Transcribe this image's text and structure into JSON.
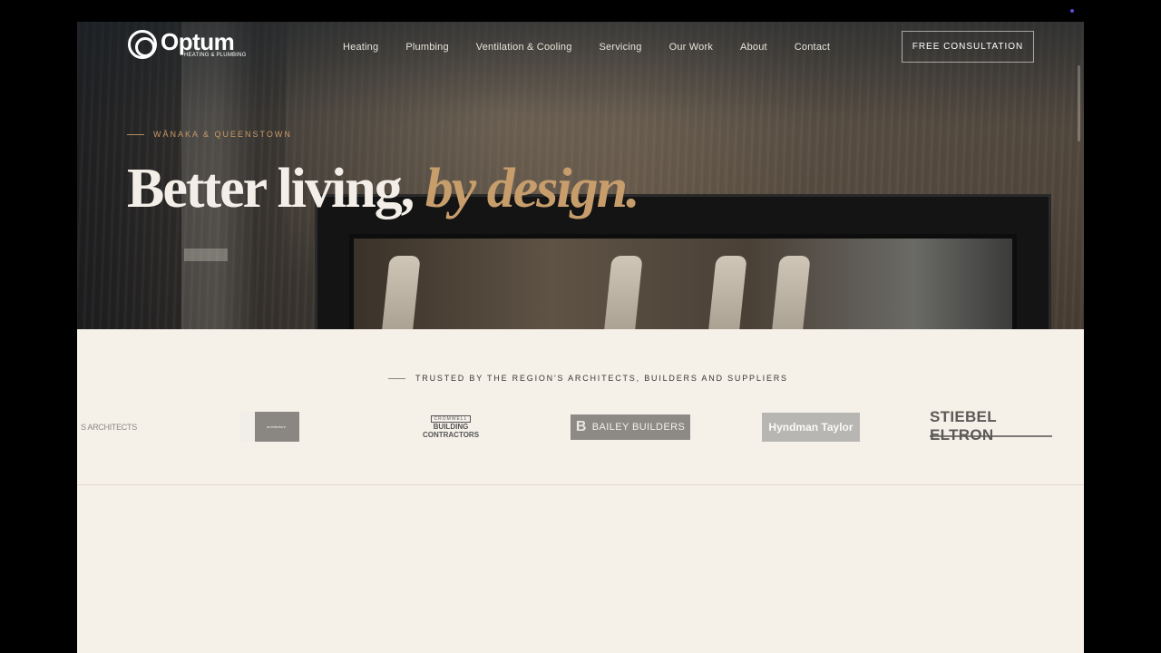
{
  "nav": {
    "brand_name": "Optum",
    "brand_sub": "HEATING & PLUMBING",
    "links": [
      {
        "label": "Heating"
      },
      {
        "label": "Plumbing"
      },
      {
        "label": "Ventilation & Cooling"
      },
      {
        "label": "Servicing"
      },
      {
        "label": "Our Work"
      },
      {
        "label": "About"
      },
      {
        "label": "Contact"
      }
    ],
    "cta_label": "FREE CONSULTATION"
  },
  "hero": {
    "eyebrow": "WĀNAKA & QUEENSTOWN",
    "headline_plain": "Better living, ",
    "headline_accent": "by design."
  },
  "trusted": {
    "label": "TRUSTED BY THE REGION'S ARCHITECTS, BUILDERS AND SUPPLIERS",
    "logos": [
      {
        "name": "partner-architects",
        "text": "S ARCHITECTS"
      },
      {
        "name": "partner-architecture",
        "text": "architecture"
      },
      {
        "name": "cromwell-building",
        "top": "CROMWELL",
        "main": "BUILDING",
        "sub": "CONTRACTORS"
      },
      {
        "name": "bailey-builders",
        "mark": "B",
        "text": "BAILEY BUILDERS"
      },
      {
        "name": "hyndman-taylor",
        "text": "Hyndman Taylor"
      },
      {
        "name": "stiebel-eltron",
        "text": "STIEBEL ELTRON"
      }
    ]
  },
  "colors": {
    "accent": "#c79d6c",
    "background": "#f5f0e8"
  }
}
